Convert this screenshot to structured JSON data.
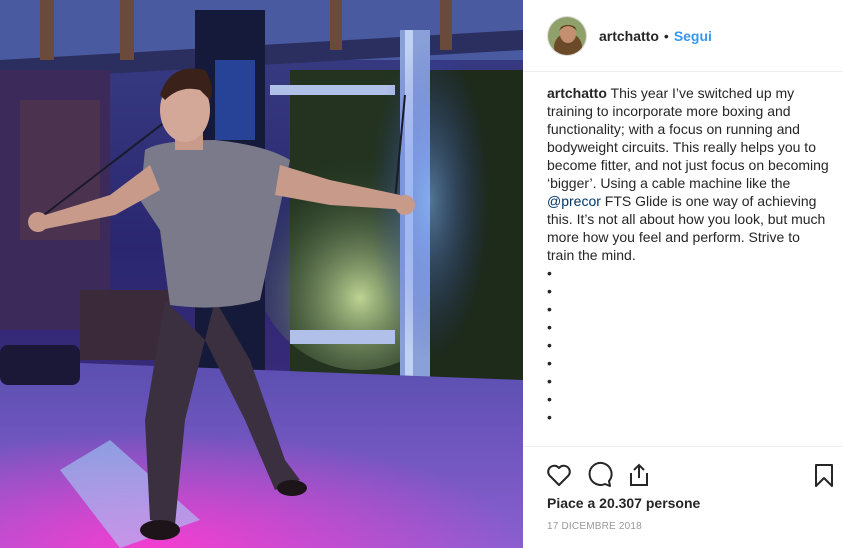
{
  "post": {
    "photo_alt": "Man training on a cable machine under blue and pink light",
    "header": {
      "username": "artchatto",
      "separator": "•",
      "follow_label": "Segui",
      "avatar_icon": "profile-avatar"
    },
    "caption": {
      "username": "artchatto",
      "text_before": "This year I’ve switched up my training to incorporate more boxing and functionality; with a focus on running and bodyweight circuits. This really helps you to become fitter, and not just focus on becoming ‘bigger’. Using a cable machine like the",
      "mention": "@precor",
      "text_after": "FTS Glide is one way of achieving this. It’s not all about how you look, but much more how you feel and perform. Strive to train the mind.",
      "bullets": [
        "•",
        "•",
        "•",
        "•",
        "•",
        "•",
        "•",
        "•",
        "•"
      ]
    },
    "actions": {
      "like_icon": "heart-icon",
      "comment_icon": "comment-icon",
      "share_icon": "share-icon",
      "save_icon": "bookmark-icon"
    },
    "likes_text": "Piace a 20.307 persone",
    "date_text": "17 DICEMBRE 2018"
  },
  "colors": {
    "link_blue": "#3897f0",
    "mention_blue": "#003569",
    "text": "#262626",
    "muted": "#999999",
    "divider": "#efefef"
  }
}
